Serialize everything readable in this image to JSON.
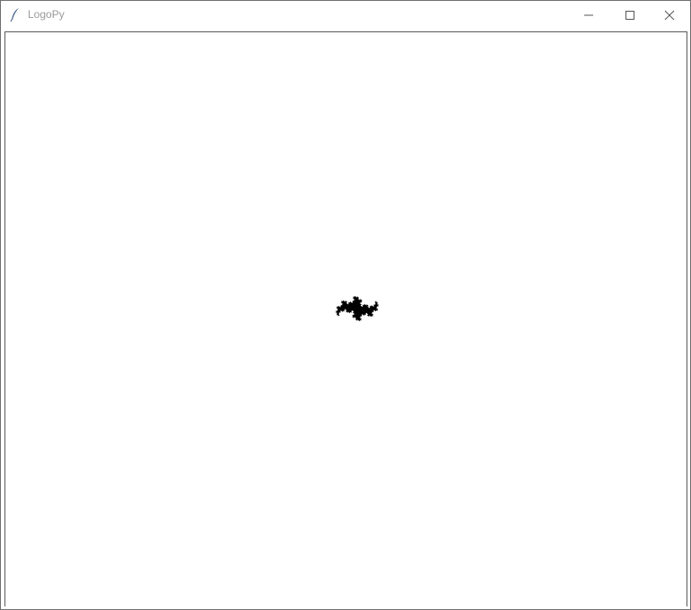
{
  "window": {
    "title": "LogoPy",
    "icon": "feather-icon",
    "controls": [
      "minimize-icon",
      "maximize-icon",
      "close-icon"
    ]
  },
  "canvas": {
    "background": "#ffffff",
    "stroke_color": "#000000",
    "content": "turtle-fractal-drawing"
  }
}
